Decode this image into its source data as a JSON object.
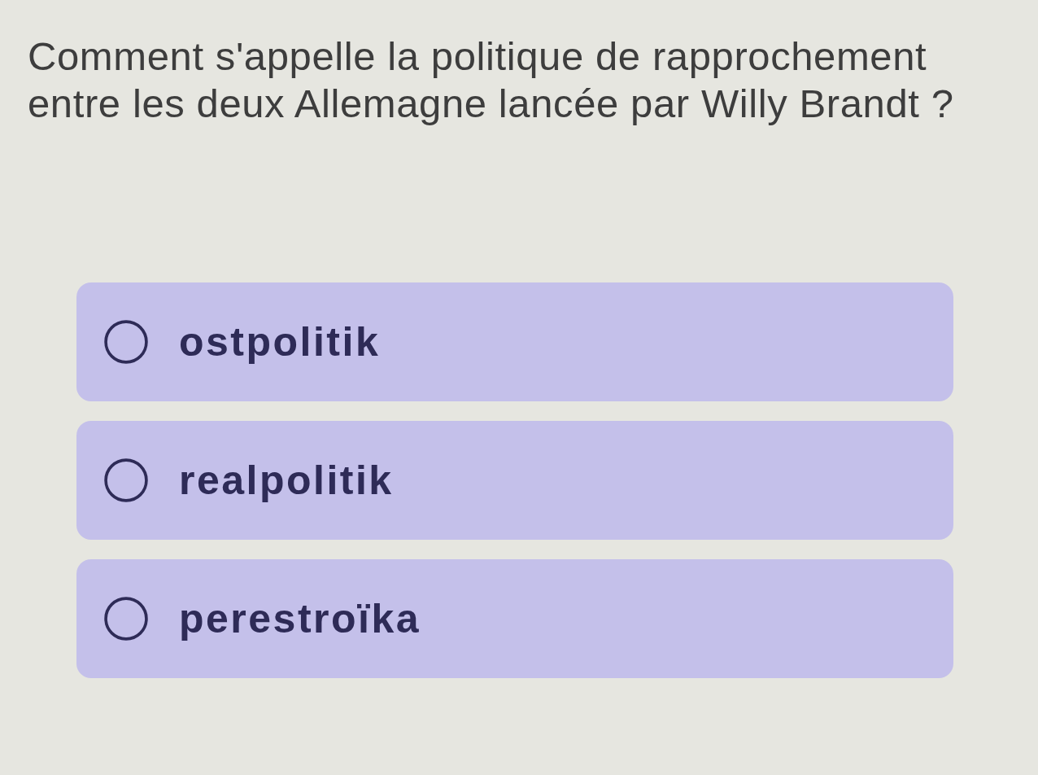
{
  "question": {
    "text": "Comment s'appelle la politique de rapprochement entre les deux Allemagne lancée par Willy Brandt ?"
  },
  "options": [
    {
      "label": "ostpolitik",
      "selected": false
    },
    {
      "label": "realpolitik",
      "selected": false
    },
    {
      "label": "perestroïka",
      "selected": false
    }
  ]
}
